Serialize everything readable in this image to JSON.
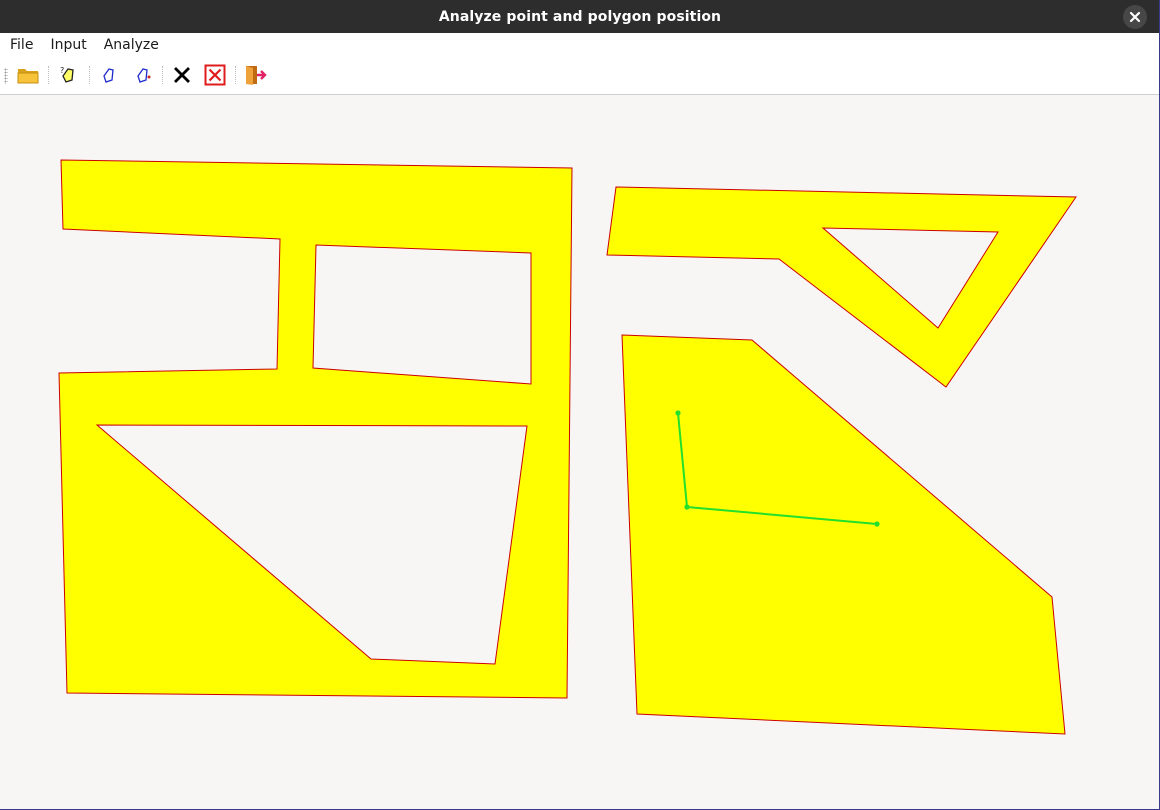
{
  "window": {
    "title": "Analyze point and polygon position"
  },
  "menu": [
    "File",
    "Input",
    "Analyze"
  ],
  "toolbar": [
    {
      "name": "open-folder-icon"
    },
    {
      "name": "input-polygon-icon"
    },
    {
      "name": "polygon-icon"
    },
    {
      "name": "polygon-point-icon"
    },
    {
      "name": "clear-icon"
    },
    {
      "name": "clear-all-icon"
    },
    {
      "name": "exit-icon"
    }
  ],
  "colors": {
    "polygon_fill": "#ffff00",
    "polygon_stroke": "#cc0000",
    "polyline": "#22e02c"
  }
}
